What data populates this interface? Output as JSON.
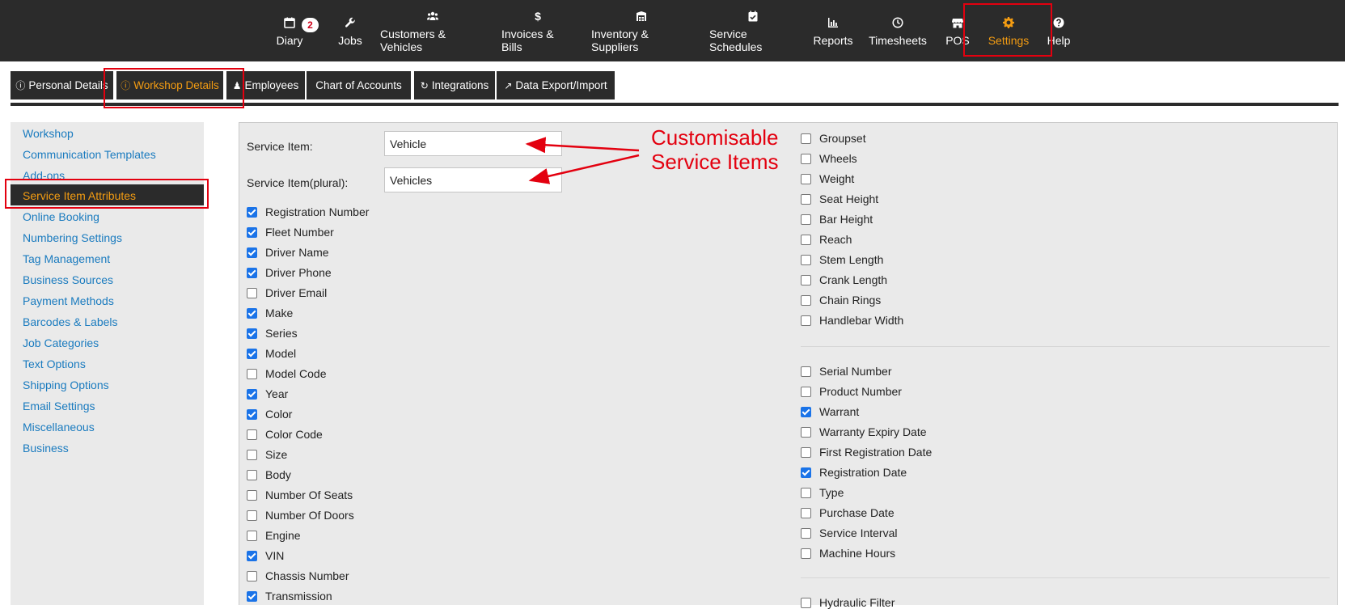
{
  "topnav": {
    "items": [
      {
        "label": "Diary",
        "icon": "calendar-icon",
        "badge": "2"
      },
      {
        "label": "Jobs",
        "icon": "wrench-icon"
      },
      {
        "label": "Customers & Vehicles",
        "icon": "users-icon"
      },
      {
        "label": "Invoices & Bills",
        "icon": "dollar-icon"
      },
      {
        "label": "Inventory & Suppliers",
        "icon": "warehouse-icon"
      },
      {
        "label": "Service Schedules",
        "icon": "calendar-check-icon"
      },
      {
        "label": "Reports",
        "icon": "bar-chart-icon"
      },
      {
        "label": "Timesheets",
        "icon": "clock-icon"
      },
      {
        "label": "POS",
        "icon": "store-icon"
      },
      {
        "label": "Settings",
        "icon": "gear-icon",
        "active": true
      },
      {
        "label": "Help",
        "icon": "question-icon"
      }
    ]
  },
  "tabs": [
    {
      "label": "Personal Details",
      "icon": "info-icon"
    },
    {
      "label": "Workshop Details",
      "icon": "info-icon",
      "active": true
    },
    {
      "label": "Employees",
      "icon": "user-icon"
    },
    {
      "label": "Chart of Accounts",
      "icon": ""
    },
    {
      "label": "Integrations",
      "icon": "refresh-icon"
    },
    {
      "label": "Data Export/Import",
      "icon": "share-icon"
    }
  ],
  "sidebar": {
    "items": [
      "Workshop",
      "Communication Templates",
      "Add-ons",
      "Service Item Attributes",
      "Online Booking",
      "Numbering Settings",
      "Tag Management",
      "Business Sources",
      "Payment Methods",
      "Barcodes & Labels",
      "Job Categories",
      "Text Options",
      "Shipping Options",
      "Email Settings",
      "Miscellaneous",
      "Business"
    ],
    "active_index": 3
  },
  "form": {
    "service_item_label": "Service Item:",
    "service_item_value": "Vehicle",
    "service_item_plural_label": "Service Item(plural):",
    "service_item_plural_value": "Vehicles"
  },
  "attributes_left": [
    {
      "label": "Registration Number",
      "checked": true
    },
    {
      "label": "Fleet Number",
      "checked": true
    },
    {
      "label": "Driver Name",
      "checked": true
    },
    {
      "label": "Driver Phone",
      "checked": true
    },
    {
      "label": "Driver Email",
      "checked": false
    },
    {
      "label": "Make",
      "checked": true
    },
    {
      "label": "Series",
      "checked": true
    },
    {
      "label": "Model",
      "checked": true
    },
    {
      "label": "Model Code",
      "checked": false
    },
    {
      "label": "Year",
      "checked": true
    },
    {
      "label": "Color",
      "checked": true
    },
    {
      "label": "Color Code",
      "checked": false
    },
    {
      "label": "Size",
      "checked": false
    },
    {
      "label": "Body",
      "checked": false
    },
    {
      "label": "Number Of Seats",
      "checked": false
    },
    {
      "label": "Number Of Doors",
      "checked": false
    },
    {
      "label": "Engine",
      "checked": false
    },
    {
      "label": "VIN",
      "checked": true
    },
    {
      "label": "Chassis Number",
      "checked": false
    },
    {
      "label": "Transmission",
      "checked": true
    }
  ],
  "attributes_right_group1": [
    {
      "label": "Groupset",
      "checked": false
    },
    {
      "label": "Wheels",
      "checked": false
    },
    {
      "label": "Weight",
      "checked": false
    },
    {
      "label": "Seat Height",
      "checked": false
    },
    {
      "label": "Bar Height",
      "checked": false
    },
    {
      "label": "Reach",
      "checked": false
    },
    {
      "label": "Stem Length",
      "checked": false
    },
    {
      "label": "Crank Length",
      "checked": false
    },
    {
      "label": "Chain Rings",
      "checked": false
    },
    {
      "label": "Handlebar Width",
      "checked": false
    }
  ],
  "attributes_right_group2": [
    {
      "label": "Serial Number",
      "checked": false
    },
    {
      "label": "Product Number",
      "checked": false
    },
    {
      "label": "Warrant",
      "checked": true
    },
    {
      "label": "Warranty Expiry Date",
      "checked": false
    },
    {
      "label": "First Registration Date",
      "checked": false
    },
    {
      "label": "Registration Date",
      "checked": true
    },
    {
      "label": "Type",
      "checked": false
    },
    {
      "label": "Purchase Date",
      "checked": false
    },
    {
      "label": "Service Interval",
      "checked": false
    },
    {
      "label": "Machine Hours",
      "checked": false
    }
  ],
  "attributes_right_group3": [
    {
      "label": "Hydraulic Filter",
      "checked": false
    }
  ],
  "annotation": {
    "line1": "Customisable",
    "line2": "Service Items",
    "color": "#e3000f"
  },
  "colors": {
    "accent": "#f39c12",
    "nav_bg": "#2b2b2b",
    "link": "#1a7bbf",
    "checkbox": "#1a73e8"
  }
}
